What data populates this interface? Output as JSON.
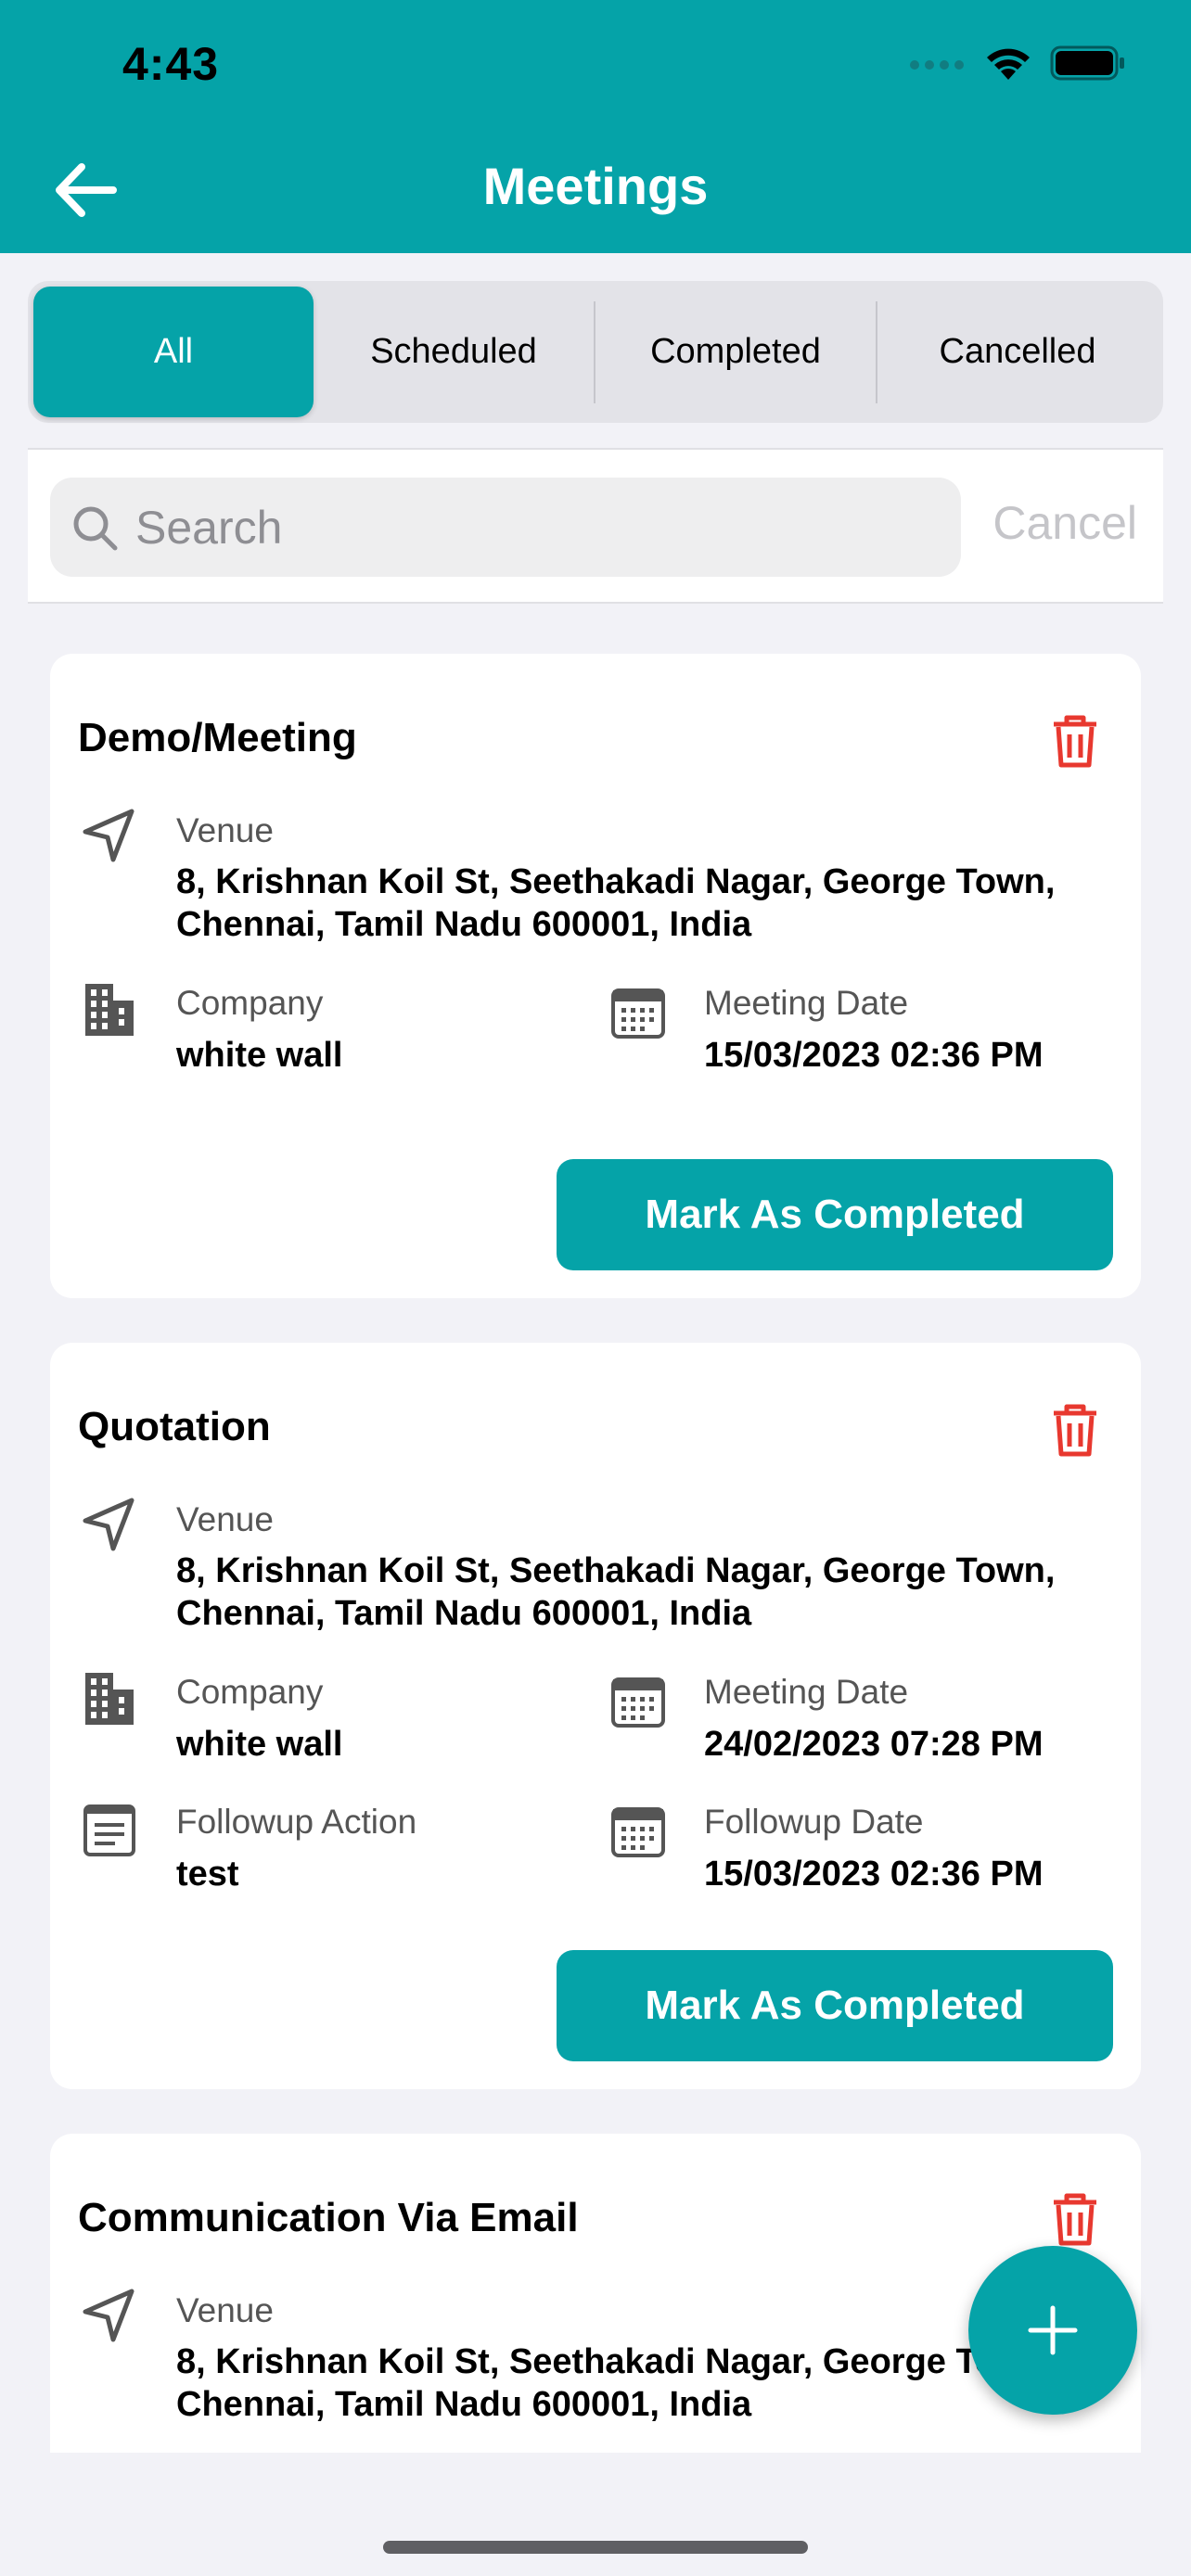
{
  "status_bar": {
    "time": "4:43"
  },
  "header": {
    "title": "Meetings"
  },
  "tabs": [
    {
      "label": "All",
      "active": true
    },
    {
      "label": "Scheduled",
      "active": false
    },
    {
      "label": "Completed",
      "active": false
    },
    {
      "label": "Cancelled",
      "active": false
    }
  ],
  "search": {
    "placeholder": "Search",
    "cancel_label": "Cancel"
  },
  "colors": {
    "accent": "#05a3a8",
    "danger": "#e8382f",
    "background": "#f2f2f7"
  },
  "meetings": [
    {
      "title": "Demo/Meeting",
      "venue_label": "Venue",
      "venue_line1": "8, Krishnan Koil St, Seethakadi Nagar, George Town,",
      "venue_line2": "Chennai, Tamil Nadu 600001, India",
      "company_label": "Company",
      "company": "white wall",
      "meeting_date_label": "Meeting Date",
      "meeting_date": "15/03/2023 02:36 PM",
      "button_label": "Mark As Completed"
    },
    {
      "title": "Quotation",
      "venue_label": "Venue",
      "venue_line1": "8, Krishnan Koil St, Seethakadi Nagar, George Town,",
      "venue_line2": "Chennai, Tamil Nadu 600001, India",
      "company_label": "Company",
      "company": "white wall",
      "meeting_date_label": "Meeting Date",
      "meeting_date": "24/02/2023 07:28 PM",
      "followup_action_label": "Followup Action",
      "followup_action": "test",
      "followup_date_label": "Followup Date",
      "followup_date": "15/03/2023 02:36 PM",
      "button_label": "Mark As Completed"
    },
    {
      "title": "Communication Via Email",
      "venue_label": "Venue",
      "venue_line1": "8, Krishnan Koil St, Seethakadi Nagar, George To",
      "venue_line2": "Chennai, Tamil Nadu 600001, India"
    }
  ],
  "icons": {
    "back": "arrow-left-icon",
    "search": "search-icon",
    "delete": "trash-icon",
    "venue": "navigation-arrow-icon",
    "company": "building-icon",
    "date": "calendar-icon",
    "followup_action": "document-icon",
    "add": "plus-icon"
  }
}
